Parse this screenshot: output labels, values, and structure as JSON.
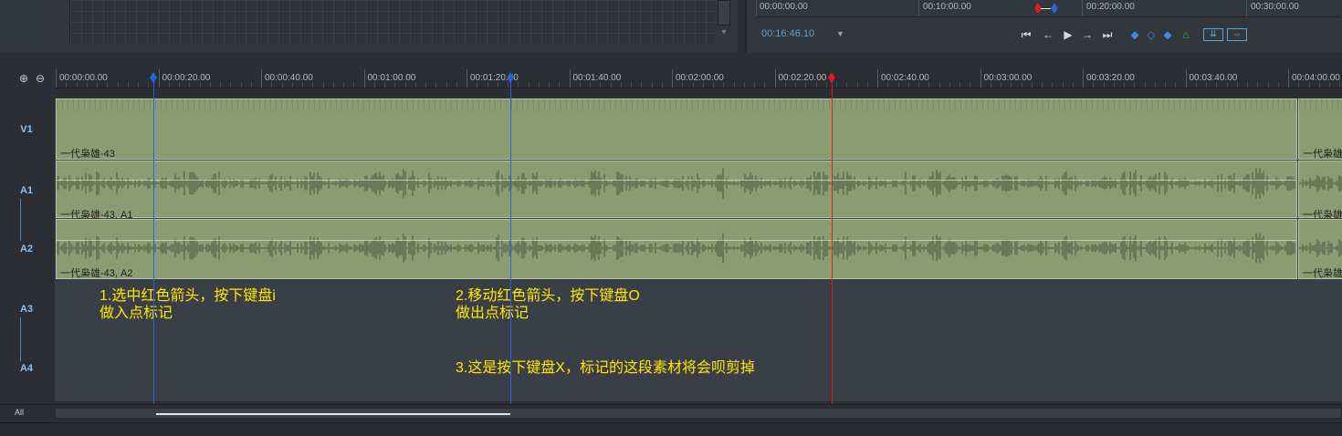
{
  "top_ruler": {
    "labels": [
      "00:00:00.00",
      "00:10:00.00",
      "00:20:00.00",
      "00:30:00.00"
    ]
  },
  "monitor": {
    "timecode": "00:16:46.10"
  },
  "transport_icons": [
    "go-to-start-icon",
    "step-back-icon",
    "play-icon",
    "step-forward-icon",
    "go-to-end-icon",
    "mark-in-icon",
    "marker-icon",
    "mark-out-icon",
    "snapshot-icon",
    "insert-icon",
    "overwrite-icon"
  ],
  "timeline": {
    "ruler_labels": [
      "00:00:00.00",
      "00:00:20.00",
      "00:00:40.00",
      "00:01:00.00",
      "00:01:20.00",
      "00:01:40.00",
      "00:02:00.00",
      "00:02:20.00",
      "00:02:40.00",
      "00:03:00.00",
      "00:03:20.00",
      "00:03:40.00",
      "00:04:00.00"
    ],
    "in_point": "00:00:19",
    "out_point": "00:01:21",
    "playhead": "00:02:21"
  },
  "tracks": {
    "v1": "V1",
    "a1": "A1",
    "a2": "A2",
    "a3": "A3",
    "a4": "A4",
    "all": "All"
  },
  "clips": {
    "v1_label": "一代枭雄-43",
    "v1_label_2": "一代枭雄",
    "a1_label": "一代枭雄-43, A1",
    "a1_label_2": "一代枭雄",
    "a2_label": "一代枭雄-43, A2",
    "a2_label_2": "一代枭雄"
  },
  "annotations": {
    "note1_line1": "1.选中红色箭头，按下键盘i",
    "note1_line2": "做入点标记",
    "note2_line1": "2.移动红色箭头，按下键盘O",
    "note2_line2": "做出点标记",
    "note3": "3.这是按下键盘X，标记的这段素材将会呗剪掉"
  },
  "colors": {
    "in_out_marker": "#2a62d8",
    "playhead": "#e01d1d",
    "clip": "#8a9c72",
    "annotation": "#ffe700",
    "timecode": "#5aa3d9"
  }
}
